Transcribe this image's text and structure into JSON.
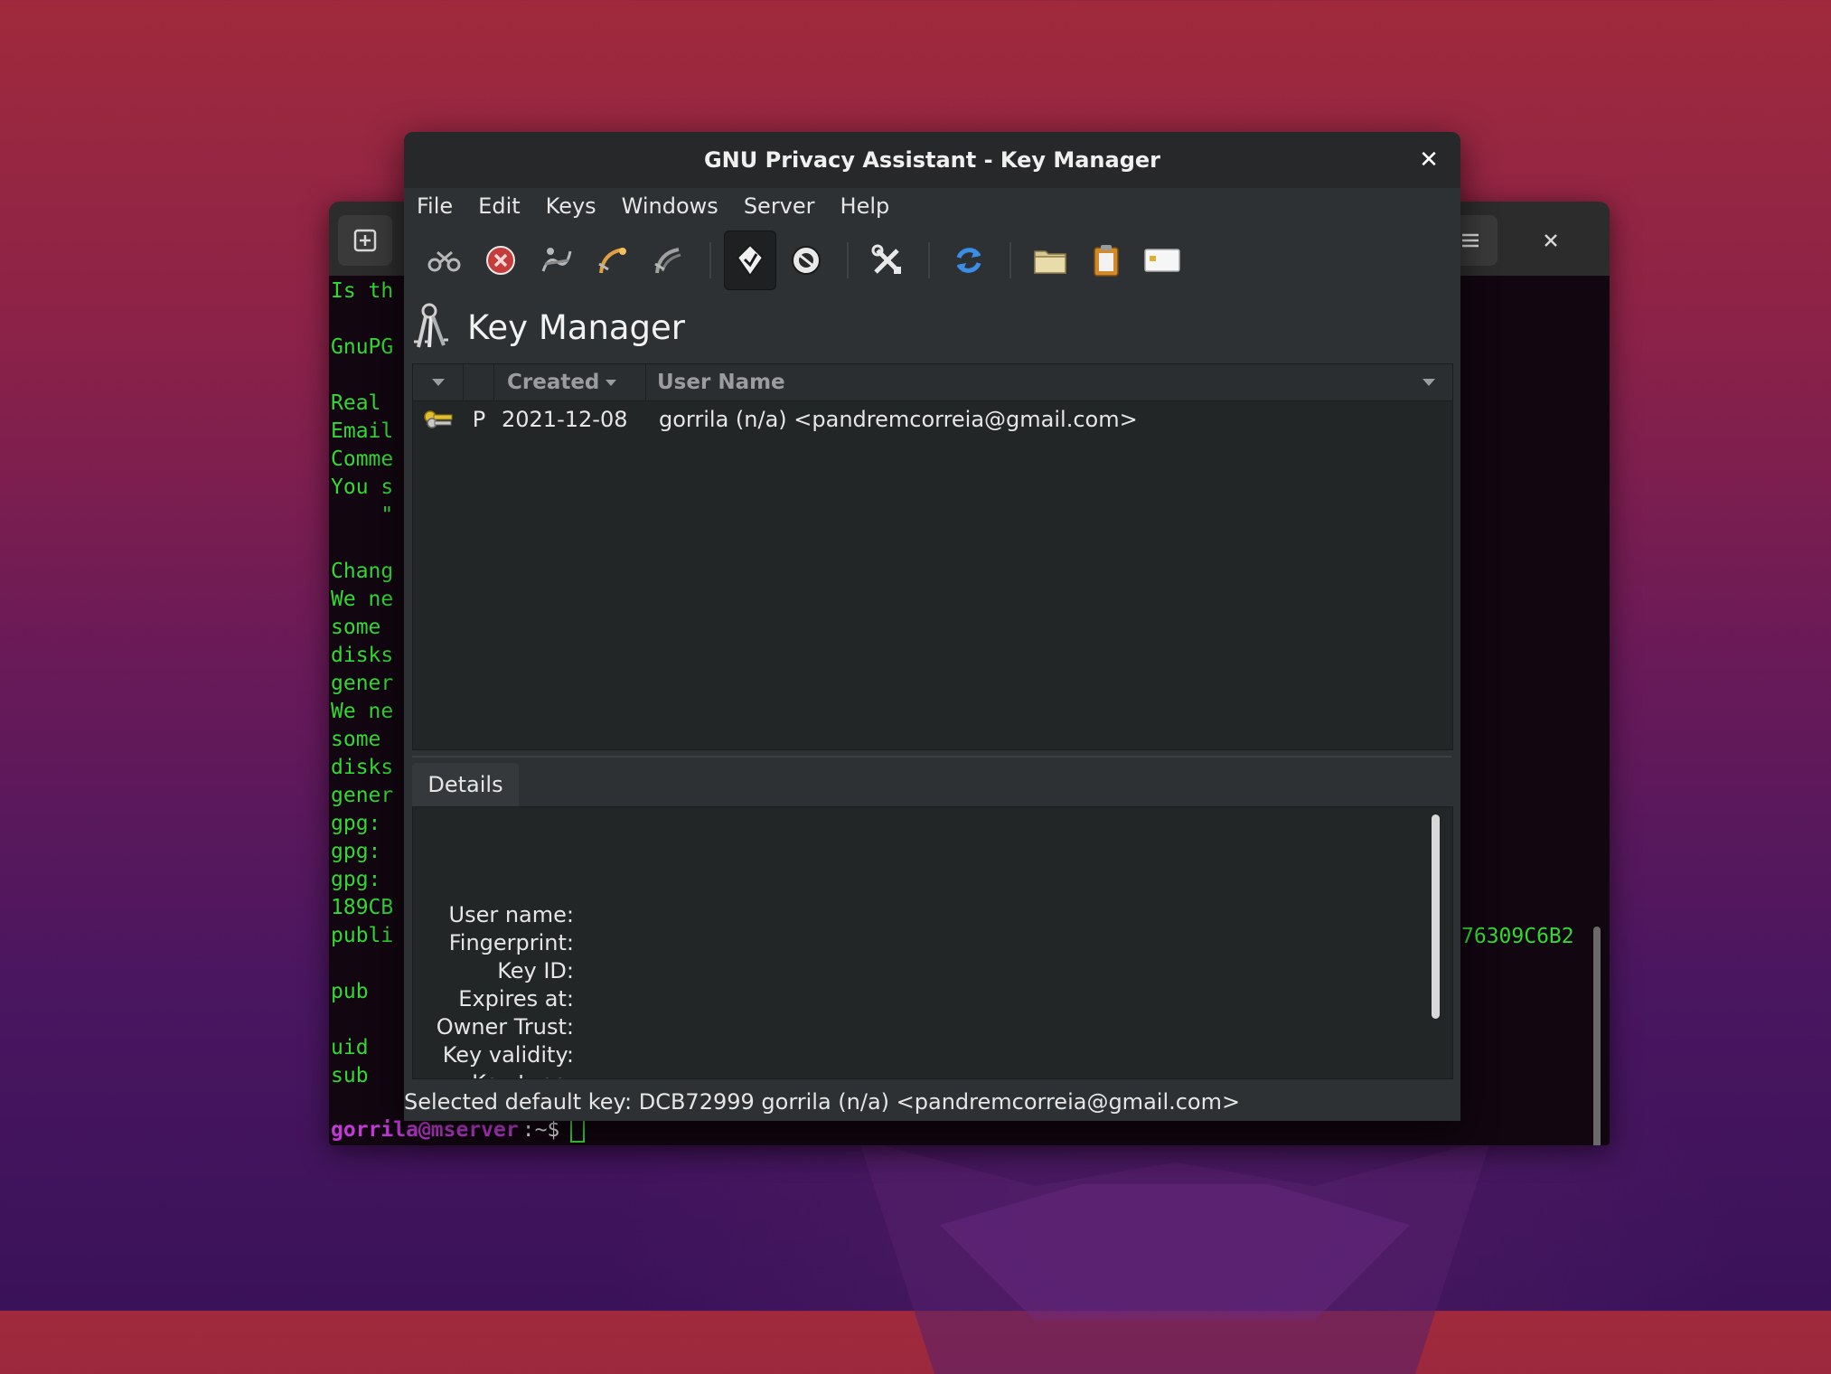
{
  "terminal": {
    "lines": [
      "Is th",
      "",
      "GnuPG",
      "",
      "Real ",
      "Email",
      "Comme",
      "You s",
      "    \"",
      "",
      "Chang",
      "We ne",
      "some ",
      "disks",
      "gener",
      "We ne",
      "some ",
      "disks",
      "gener",
      "gpg: ",
      "gpg: ",
      "gpg: ",
      "189CB",
      "publi",
      "",
      "pub",
      "",
      "uid",
      "sub"
    ],
    "right_text": "76309C6B2",
    "prompt_user_host": "gorrila@mserver",
    "prompt_path": ":~$"
  },
  "window": {
    "title": "GNU Privacy Assistant - Key Manager",
    "close_glyph": "✕"
  },
  "menu": [
    "File",
    "Edit",
    "Keys",
    "Windows",
    "Server",
    "Help"
  ],
  "toolbar": {
    "buttons": [
      {
        "icon": "edit-key-icon"
      },
      {
        "icon": "delete-key-icon"
      },
      {
        "icon": "sign-key-icon"
      },
      {
        "icon": "import-key-icon"
      },
      {
        "icon": "export-key-icon"
      },
      {
        "icon": "brief-view-icon",
        "active": true
      },
      {
        "icon": "detailed-view-icon"
      },
      {
        "icon": "preferences-icon"
      },
      {
        "icon": "refresh-icon"
      },
      {
        "icon": "file-manager-icon"
      },
      {
        "icon": "clipboard-icon"
      },
      {
        "icon": "smartcard-icon"
      }
    ]
  },
  "heading": "Key Manager",
  "keylist": {
    "columns": [
      "",
      "",
      "Created",
      "User Name"
    ],
    "rows": [
      {
        "type": "P",
        "created": "2021-12-08",
        "user_name": "gorrila (n/a) <pandremcorreia@gmail.com>"
      }
    ]
  },
  "details": {
    "tab": "Details",
    "labels": [
      "User name:",
      "Fingerprint:",
      "Key ID:",
      "Expires at:",
      "Owner Trust:",
      "Key validity:",
      "Key type:"
    ]
  },
  "status": "Selected default key: DCB72999 gorrila (n/a) <pandremcorreia@gmail.com>",
  "colors": {
    "terminal_text": "#33d833",
    "prompt": "#c23ad8",
    "window_bg": "#2d3133"
  }
}
